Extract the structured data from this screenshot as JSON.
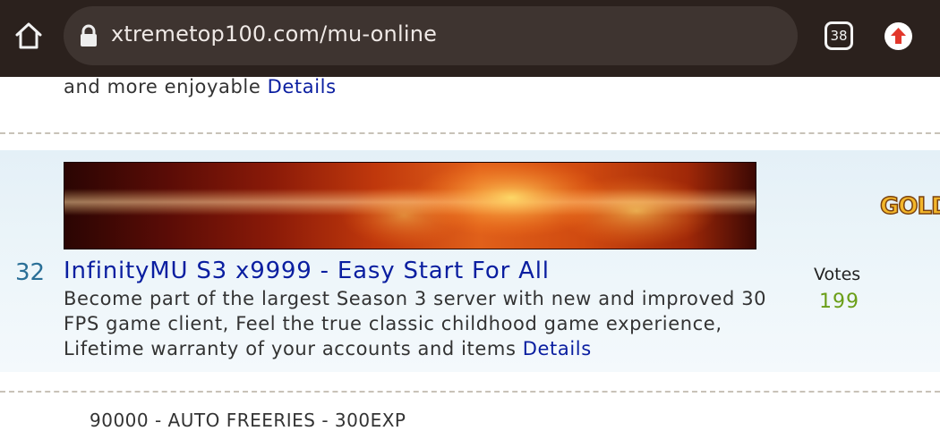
{
  "browser": {
    "url": "xtremetop100.com/mu-online",
    "tab_count": "38"
  },
  "previous_listing": {
    "description_tail": "and more enjoyable ",
    "details_link": "Details"
  },
  "listing": {
    "rank": "32",
    "title": "InfinityMU S3 x9999 - Easy Start For All",
    "description": "Become part of the largest Season 3 server with new and improved 30 FPS game client, Feel the true classic childhood game experience, Lifetime warranty of your accounts and items ",
    "details_link": "Details",
    "votes_label": "Votes",
    "votes_count": "199",
    "side_ad_text": "GOLD"
  },
  "next_listing": {
    "title_partial": "90000 - AUTO FREERIES - 300EXP"
  },
  "colors": {
    "topbar_bg": "#2b211d",
    "link": "#0a1ea0",
    "rank": "#2a6f97",
    "votes_count": "#6a9e17",
    "update_arrow": "#e2372b"
  },
  "icons": {
    "home": "home-icon",
    "lock": "lock-icon",
    "update": "arrow-up-icon"
  }
}
